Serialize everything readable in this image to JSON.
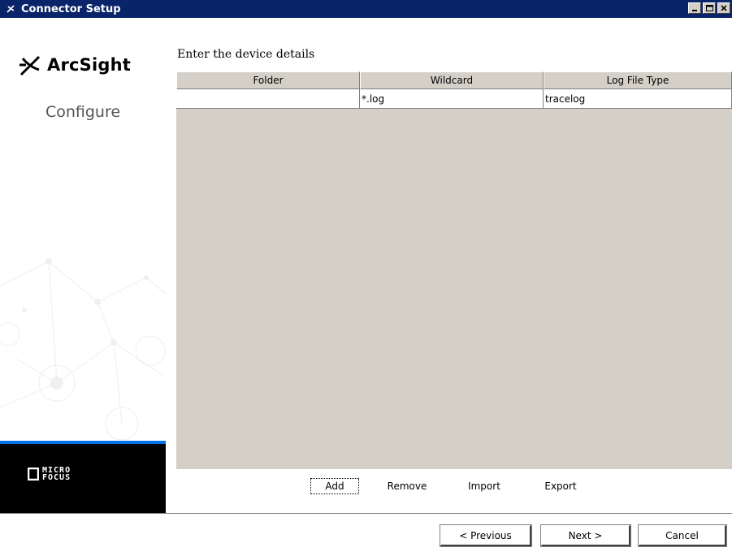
{
  "window": {
    "title": "Connector Setup",
    "controls": [
      "minimize",
      "maximize",
      "close"
    ]
  },
  "sidebar": {
    "logo_text": "ArcSight",
    "step_label": "Configure",
    "vendor_logo_lines": [
      "MICRO",
      "FOCUS"
    ]
  },
  "main": {
    "heading": "Enter the device details",
    "table": {
      "columns": [
        "Folder",
        "Wildcard",
        "Log File Type"
      ],
      "rows": [
        [
          "",
          "*.log",
          "tracelog"
        ]
      ]
    },
    "actions": {
      "add": "Add",
      "remove": "Remove",
      "import": "Import",
      "export": "Export"
    }
  },
  "footer": {
    "previous": "< Previous",
    "next": "Next >",
    "cancel": "Cancel"
  },
  "colors": {
    "titlebar": "#0a246a",
    "accent_line": "#0073e7",
    "table_bg": "#d4d0c8"
  }
}
